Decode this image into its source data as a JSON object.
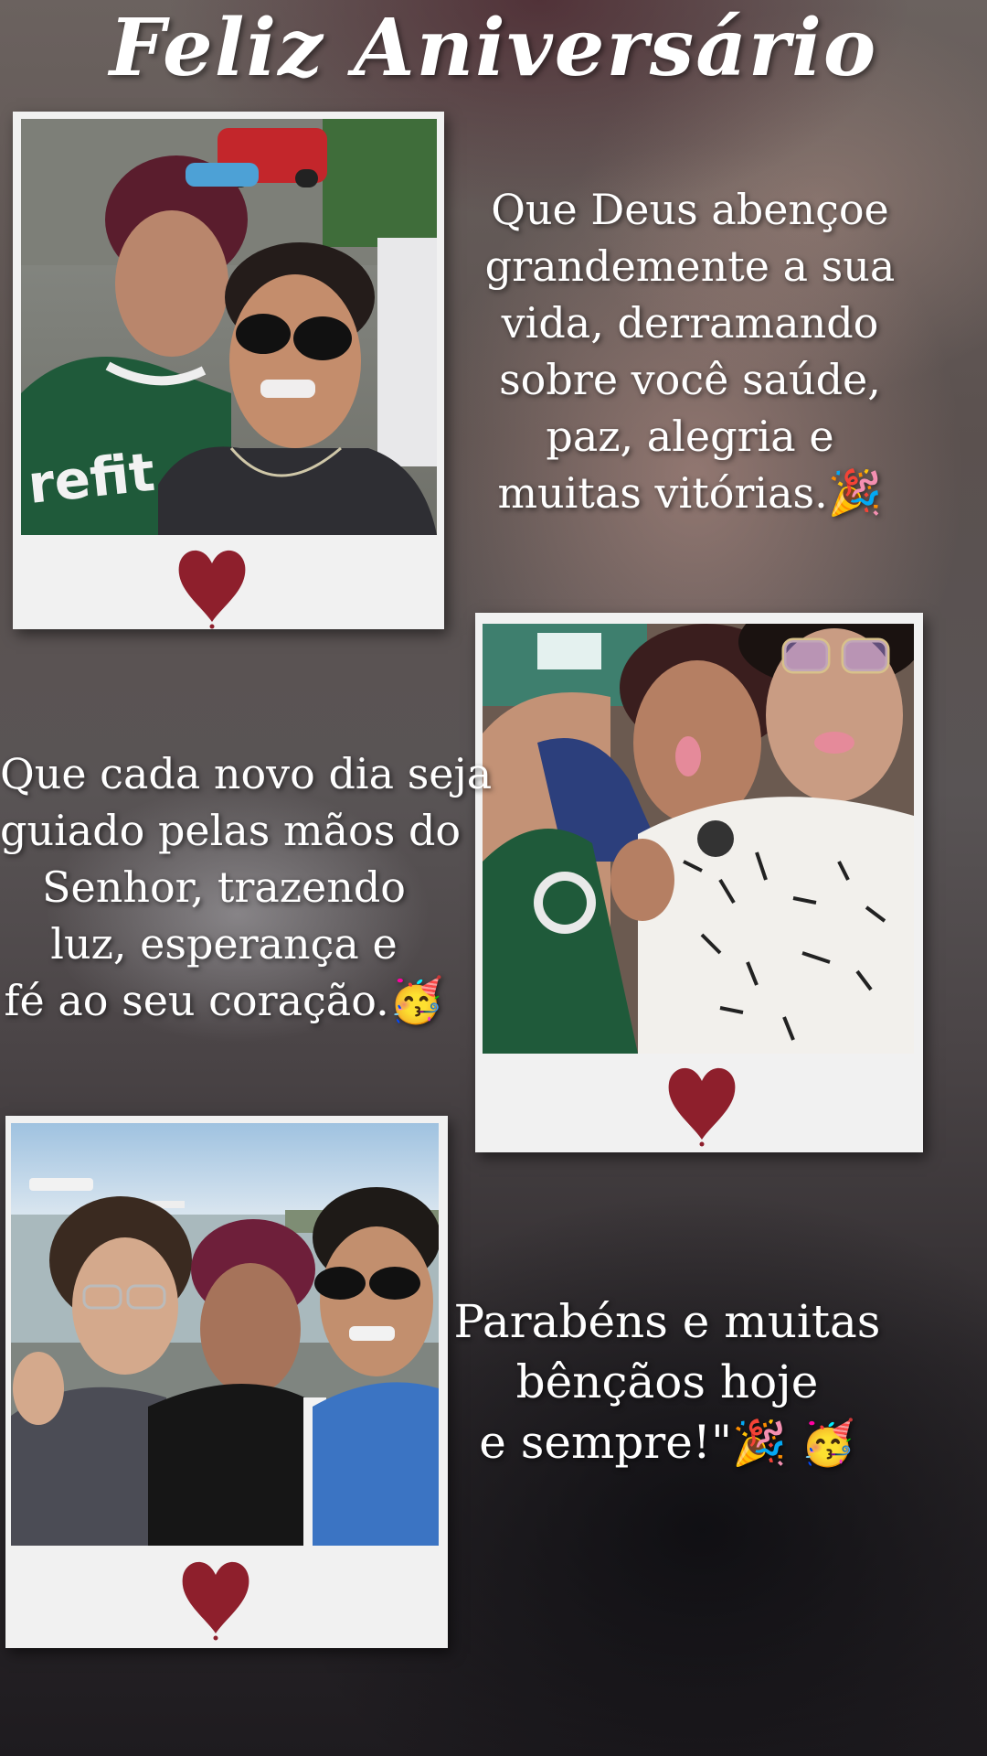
{
  "title": "Feliz Aniversário",
  "messages": [
    {
      "lines": [
        "Que Deus abençoe",
        "grandemente a sua",
        "vida, derramando",
        "sobre você saúde,",
        "paz, alegria e",
        "muitas vitórias."
      ],
      "emoji": "🎉"
    },
    {
      "lines": [
        "Que cada novo dia seja",
        "guiado pelas mãos do",
        "Senhor, trazendo",
        "luz, esperança e",
        "fé ao seu coração."
      ],
      "emoji": "🥳"
    },
    {
      "lines": [
        "Parabéns e muitas",
        "bênçãos hoje",
        "e sempre!\""
      ],
      "emoji": "🎉 🥳"
    }
  ],
  "polaroids": [
    {
      "photo": "selfie-two-people-street",
      "heart": "heart-icon"
    },
    {
      "photo": "selfie-two-girls-beach",
      "heart": "heart-icon"
    },
    {
      "photo": "group-three-people-beach",
      "heart": "heart-icon"
    }
  ],
  "colors": {
    "heart": "#8e1f2c",
    "frame": "#f1f1f1",
    "text": "#ffffff"
  }
}
